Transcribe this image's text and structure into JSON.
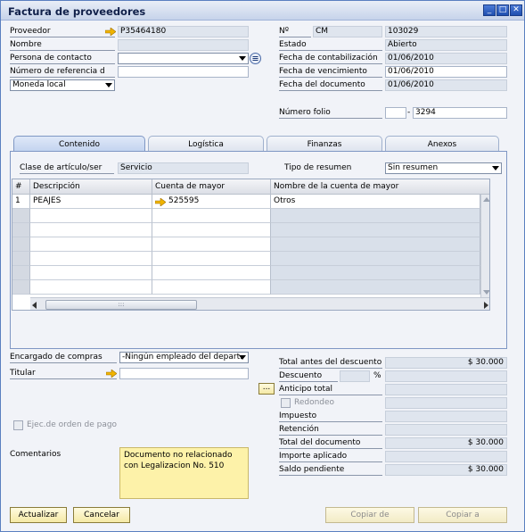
{
  "window": {
    "title": "Factura de proveedores",
    "minimize": "_",
    "maximize": "□",
    "close": "✕"
  },
  "header_left": {
    "proveedor_label": "Proveedor",
    "proveedor_value": "P35464180",
    "nombre_label": "Nombre",
    "nombre_value": "",
    "persona_label": "Persona de contacto",
    "persona_value": "",
    "referencia_label": "Número de referencia d",
    "referencia_value": "",
    "moneda_value": "Moneda local"
  },
  "header_right": {
    "no_label": "Nº",
    "series_value": "CM",
    "doc_number": "103029",
    "estado_label": "Estado",
    "estado_value": "Abierto",
    "contab_label": "Fecha de contabilización",
    "contab_value": "01/06/2010",
    "venc_label": "Fecha de vencimiento",
    "venc_value": "01/06/2010",
    "docfecha_label": "Fecha del documento",
    "docfecha_value": "01/06/2010",
    "folio_label": "Número folio",
    "folio_prefix": "",
    "folio_sep": "-",
    "folio_value": "3294"
  },
  "tabs": [
    "Contenido",
    "Logística",
    "Finanzas",
    "Anexos"
  ],
  "contenido": {
    "clase_label": "Clase de artículo/ser",
    "clase_value": "Servicio",
    "tipo_label": "Tipo de resumen",
    "tipo_value": "Sin resumen",
    "columns": [
      "#",
      "Descripción",
      "Cuenta de mayor",
      "Nombre de la cuenta de mayor"
    ],
    "rows": [
      {
        "num": "1",
        "desc": "PEAJES",
        "cuenta": "525595",
        "nombre": "Otros"
      }
    ],
    "scroll_grip": ":::"
  },
  "footer_left": {
    "encargado_label": "Encargado de compras",
    "encargado_value": "-Ningún empleado del depart.",
    "titular_label": "Titular",
    "titular_value": "",
    "ejec_label": "Ejec.de orden de pago",
    "comentarios_label": "Comentarios",
    "comentarios_value": "Documento no relacionado con Legalizacion No. 510"
  },
  "totals": {
    "antes_label": "Total antes del descuento",
    "antes_value": "$ 30.000",
    "descuento_label": "Descuento",
    "descuento_pct": "",
    "pct_sign": "%",
    "descuento_value": "",
    "anticipo_label": "Anticipo total",
    "anticipo_value": "",
    "redondeo_label": "Redondeo",
    "redondeo_value": "",
    "impuesto_label": "Impuesto",
    "impuesto_value": "",
    "retencion_label": "Retención",
    "retencion_value": "",
    "total_label": "Total del documento",
    "total_value": "$ 30.000",
    "importe_label": "Importe aplicado",
    "importe_value": "",
    "saldo_label": "Saldo pendiente",
    "saldo_value": "$ 30.000"
  },
  "buttons": {
    "actualizar": "Actualizar",
    "cancelar": "Cancelar",
    "copiar_de": "Copiar de",
    "copiar_a": "Copiar a",
    "ellipsis": "..."
  }
}
